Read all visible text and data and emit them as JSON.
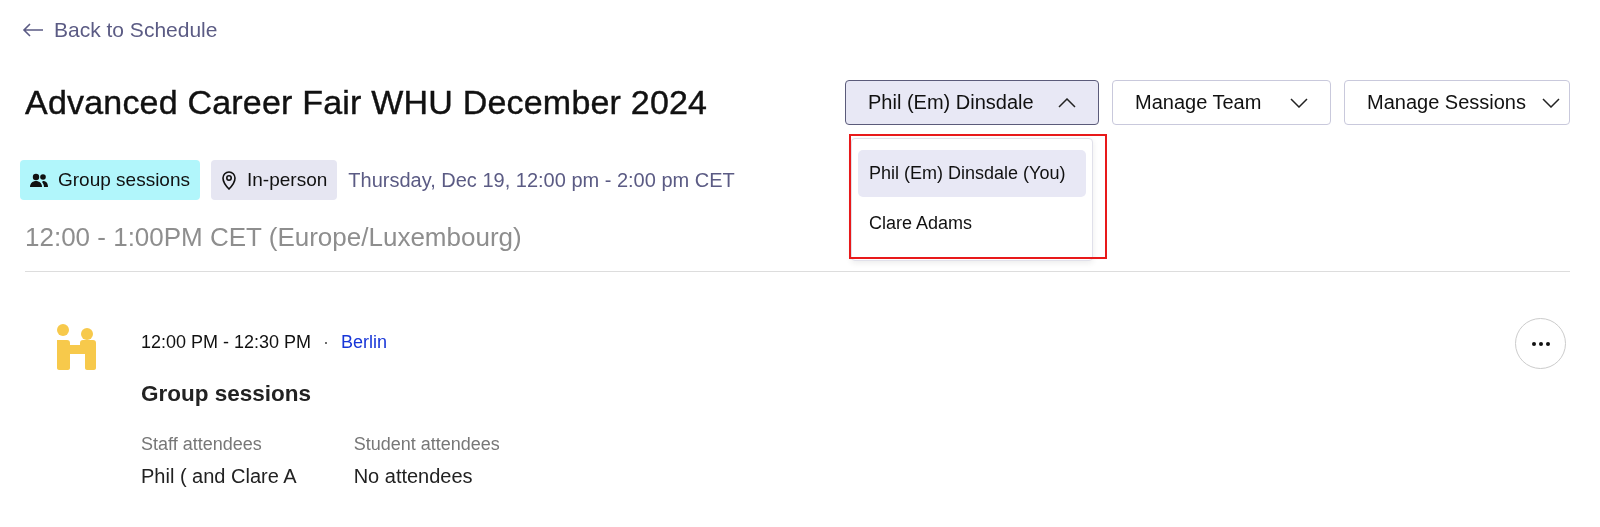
{
  "back_link": {
    "label": "Back to Schedule"
  },
  "title": "Advanced Career Fair WHU December 2024",
  "header_buttons": [
    {
      "label": "Phil (Em) Dinsdale",
      "expanded": true
    },
    {
      "label": "Manage Team",
      "expanded": false
    },
    {
      "label": "Manage Sessions",
      "expanded": false
    }
  ],
  "dropdown": {
    "items": [
      {
        "label": "Phil (Em) Dinsdale (You)",
        "selected": true
      },
      {
        "label": "Clare Adams",
        "selected": false
      }
    ]
  },
  "tags": [
    {
      "kind": "group",
      "label": "Group sessions"
    },
    {
      "kind": "location",
      "label": "In-person"
    }
  ],
  "date_text": "Thursday, Dec 19, 12:00 pm - 2:00 pm CET",
  "timezone_text": "12:00 - 1:00PM CET (Europe/Luxembourg)",
  "session": {
    "time": "12:00 PM - 12:30 PM",
    "separator": "·",
    "location": "Berlin",
    "title": "Group sessions",
    "columns": [
      {
        "label": "Staff attendees",
        "value": "Phil ( and Clare A"
      },
      {
        "label": "Student attendees",
        "value": "No attendees"
      }
    ]
  }
}
